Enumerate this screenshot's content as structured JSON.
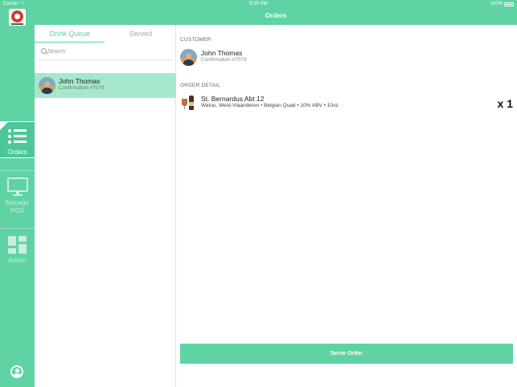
{
  "status": {
    "carrier": "Carrier",
    "time": "9:35 PM",
    "battery": "100%"
  },
  "nav": {
    "title": "Orders"
  },
  "sidebar": {
    "items": [
      {
        "label": "Orders",
        "icon": "list-icon",
        "active": true
      },
      {
        "label_line1": "Manage",
        "label_line2": "POS",
        "icon": "monitor-icon"
      },
      {
        "label": "Admin",
        "icon": "dashboard-icon"
      }
    ],
    "footer_icon": "profile-icon"
  },
  "queue": {
    "tabs": [
      {
        "label": "Drink Queue",
        "active": true
      },
      {
        "label": "Served",
        "active": false
      }
    ],
    "search": {
      "placeholder": "Search",
      "value": ""
    },
    "items": [
      {
        "name": "John Thomas",
        "confirmation": "Confirmation #7079",
        "selected": true
      }
    ]
  },
  "detail": {
    "customer_label": "CUSTOMER",
    "customer": {
      "name": "John Thomas",
      "confirmation": "Confirmation #7079"
    },
    "order_label": "ORDER DETAIL",
    "items": [
      {
        "name": "St. Bernardus Abt 12",
        "meta": "Watou, West-Vlaanderen • Belgian Quad • 10% ABV • 10oz",
        "quantity": "x 1"
      }
    ],
    "serve_button": "Serve Order"
  },
  "colors": {
    "accent": "#5fd3a3",
    "selected_row": "#a6e8cc"
  }
}
